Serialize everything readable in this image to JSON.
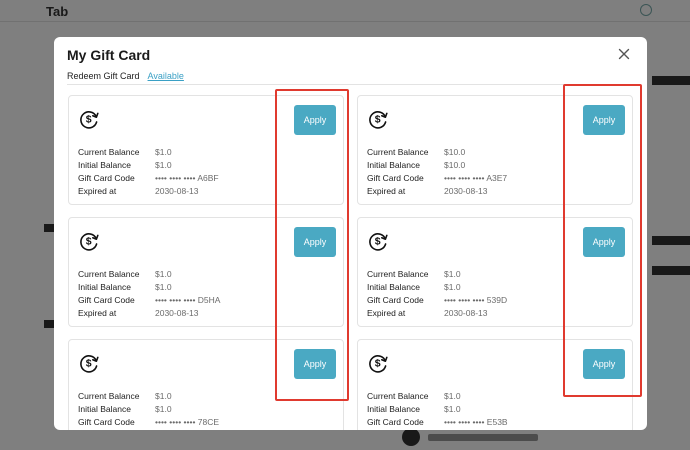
{
  "background": {
    "title": "Tab"
  },
  "modal": {
    "title": "My Gift Card",
    "tabs": {
      "label": "Redeem Gift Card",
      "link": "Available"
    }
  },
  "field_labels": {
    "current": "Current Balance",
    "initial": "Initial Balance",
    "code": "Gift Card Code",
    "expired": "Expired at"
  },
  "apply_label": "Apply",
  "cards": [
    {
      "current": "$1.0",
      "initial": "$1.0",
      "code": "•••• •••• •••• A6BF",
      "expired": "2030-08-13"
    },
    {
      "current": "$10.0",
      "initial": "$10.0",
      "code": "•••• •••• •••• A3E7",
      "expired": "2030-08-13"
    },
    {
      "current": "$1.0",
      "initial": "$1.0",
      "code": "•••• •••• •••• D5HA",
      "expired": "2030-08-13"
    },
    {
      "current": "$1.0",
      "initial": "$1.0",
      "code": "•••• •••• •••• 539D",
      "expired": "2030-08-13"
    },
    {
      "current": "$1.0",
      "initial": "$1.0",
      "code": "•••• •••• •••• 78CE",
      "expired": ""
    },
    {
      "current": "$1.0",
      "initial": "$1.0",
      "code": "•••• •••• •••• E53B",
      "expired": ""
    }
  ],
  "colors": {
    "accent": "#4aa9c3",
    "link": "#3aa0c5",
    "highlight": "#e03a2f"
  },
  "icons": {
    "card": "dollar-refresh-icon",
    "close": "close-icon"
  }
}
